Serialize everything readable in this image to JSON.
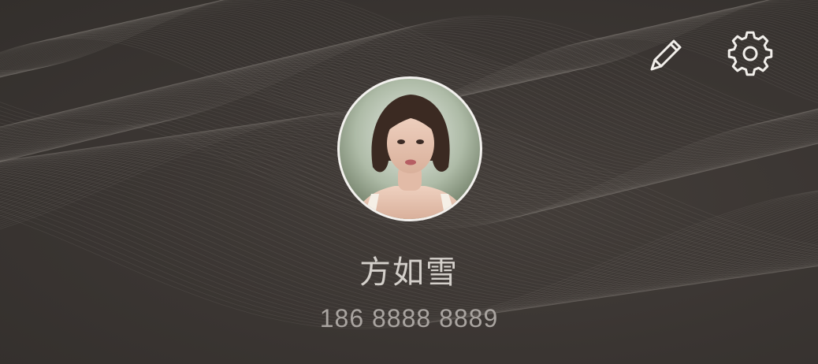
{
  "profile": {
    "name": "方如雪",
    "phone": "186 8888 8889"
  },
  "actions": {
    "edit_icon": "pencil-icon",
    "settings_icon": "gear-icon"
  },
  "colors": {
    "background": "#3a3532",
    "wave": "#8d8780",
    "text_primary": "#d4d0cb",
    "text_secondary": "#a9a4a0"
  }
}
